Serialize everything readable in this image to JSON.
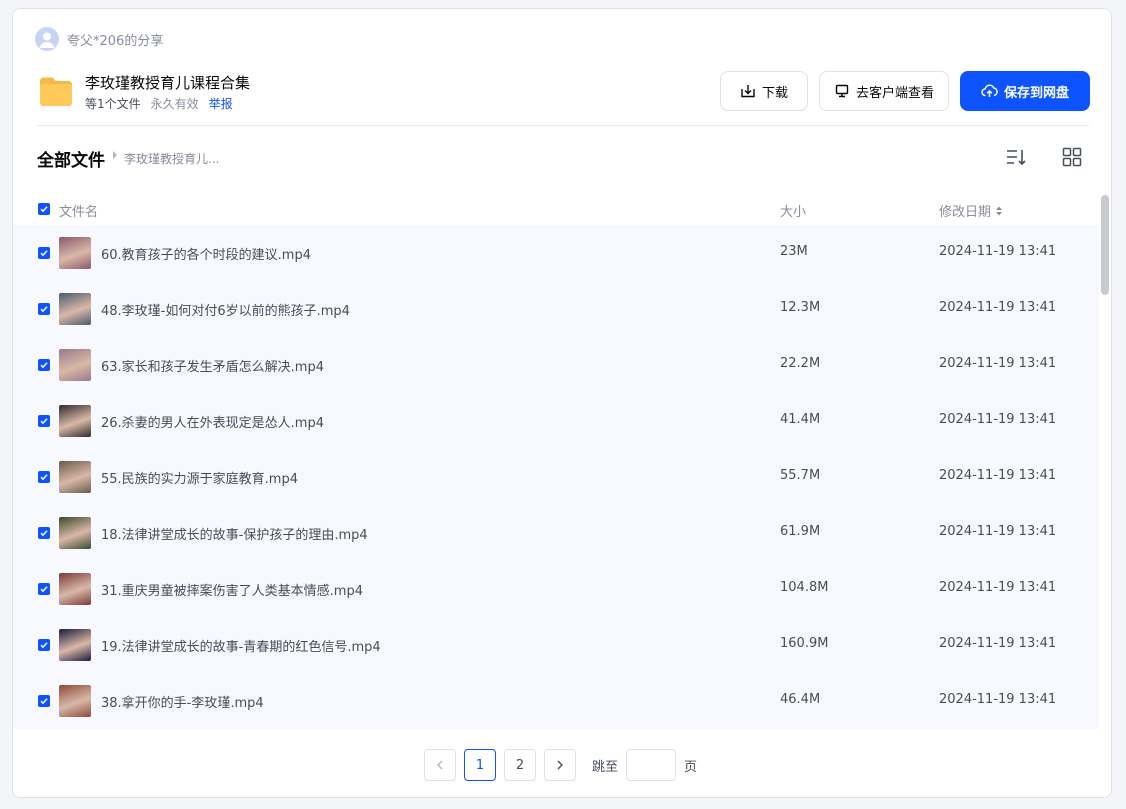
{
  "sharer": {
    "name": "夸父*206的分享"
  },
  "share": {
    "title": "李玫瑾教授育儿课程合集",
    "count": "等1个文件",
    "validity": "永久有效",
    "report_label": "举报"
  },
  "actions": {
    "download_label": "下载",
    "client_label": "去客户端查看",
    "save_label": "保存到网盘"
  },
  "breadcrumb": {
    "root": "全部文件",
    "current": "李玫瑾教授育儿..."
  },
  "columns": {
    "name": "文件名",
    "size": "大小",
    "date": "修改日期"
  },
  "files": [
    {
      "name": "60.教育孩子的各个时段的建议.mp4",
      "size": "23M",
      "date": "2024-11-19 13:41",
      "thumb_color": "#8a5a6a"
    },
    {
      "name": "48.李玫瑾-如何对付6岁以前的熊孩子.mp4",
      "size": "12.3M",
      "date": "2024-11-19 13:41",
      "thumb_color": "#4a5a6e"
    },
    {
      "name": "63.家长和孩子发生矛盾怎么解决.mp4",
      "size": "22.2M",
      "date": "2024-11-19 13:41",
      "thumb_color": "#9a7a8a"
    },
    {
      "name": "26.杀妻的男人在外表现定是怂人.mp4",
      "size": "41.4M",
      "date": "2024-11-19 13:41",
      "thumb_color": "#2e2a2c"
    },
    {
      "name": "55.民族的实力源于家庭教育.mp4",
      "size": "55.7M",
      "date": "2024-11-19 13:41",
      "thumb_color": "#6a5a4a"
    },
    {
      "name": "18.法律讲堂成长的故事-保护孩子的理由.mp4",
      "size": "61.9M",
      "date": "2024-11-19 13:41",
      "thumb_color": "#3a4a2a"
    },
    {
      "name": "31.重庆男童被摔案伤害了人类基本情感.mp4",
      "size": "104.8M",
      "date": "2024-11-19 13:41",
      "thumb_color": "#7a3a3a"
    },
    {
      "name": "19.法律讲堂成长的故事-青春期的红色信号.mp4",
      "size": "160.9M",
      "date": "2024-11-19 13:41",
      "thumb_color": "#1a1a3a"
    },
    {
      "name": "38.拿开你的手-李玫瑾.mp4",
      "size": "46.4M",
      "date": "2024-11-19 13:41",
      "thumb_color": "#8a4a3a"
    }
  ],
  "pagination": {
    "pages": [
      "1",
      "2"
    ],
    "current": "1",
    "jump_label": "跳至",
    "page_unit": "页",
    "prev_icon": "chevron-left-icon",
    "next_icon": "chevron-right-icon"
  },
  "colors": {
    "accent": "#0d53ff",
    "row_selected": "#f7f9fe",
    "folder": "#ffc95a"
  }
}
